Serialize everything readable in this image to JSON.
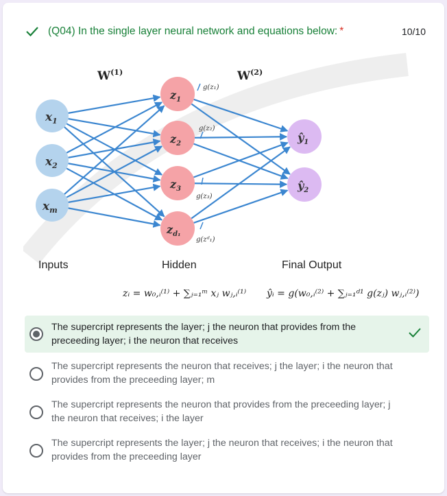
{
  "question": {
    "number": "(Q04)",
    "text": "In the single layer neural network and equations below:",
    "required_mark": "*",
    "score": "10/10",
    "status_color": "#188038"
  },
  "figure": {
    "layer_labels": [
      "Inputs",
      "Hidden",
      "Final Output"
    ],
    "weight_labels": {
      "w1": "W",
      "w1_sup": "(1)",
      "w2": "W",
      "w2_sup": "(2)"
    },
    "input_nodes": [
      {
        "name": "x",
        "sub": "1"
      },
      {
        "name": "x",
        "sub": "2"
      },
      {
        "name": "x",
        "sub": "m"
      }
    ],
    "hidden_nodes": [
      {
        "name": "z",
        "sub": "1",
        "act": "g(z₁)"
      },
      {
        "name": "z",
        "sub": "2",
        "act": "g(z₂)"
      },
      {
        "name": "z",
        "sub": "3",
        "act": "g(z₃)"
      },
      {
        "name": "z",
        "sub": "d₁",
        "act": "g(zᵈ₁)"
      }
    ],
    "output_nodes": [
      {
        "name": "ŷ",
        "sub": "1"
      },
      {
        "name": "ŷ",
        "sub": "2"
      }
    ],
    "equation_hidden": "zᵢ = w₀,ᵢ⁽¹⁾ + ∑ⱼ₌₁ᵐ xⱼ wⱼ,ᵢ⁽¹⁾",
    "equation_output": "ŷᵢ = g(w₀,ᵢ⁽²⁾ + ∑ⱼ₌₁ᵈ¹ g(zⱼ) wⱼ,ᵢ⁽²⁾)",
    "colors": {
      "input_node": "#b4d3ed",
      "hidden_node": "#f5a3a7",
      "output_node": "#dcbaf2",
      "edge": "#3b86d0"
    }
  },
  "options": [
    {
      "text": "The supercript represents the layer; j the neuron that provides from the preceeding layer; i the neuron that receives",
      "selected": true,
      "correct": true
    },
    {
      "text": "The supercript represents the neuron that receives; j the layer; i the neuron that provides from the preceeding layer; m",
      "selected": false
    },
    {
      "text": "The supercript represents the neuron that provides from the preceeding layer; j the neuron that receives; i the layer",
      "selected": false
    },
    {
      "text": "The supercript represents the layer; j the neuron that receives; i the neuron that provides from the preceeding layer",
      "selected": false
    }
  ]
}
